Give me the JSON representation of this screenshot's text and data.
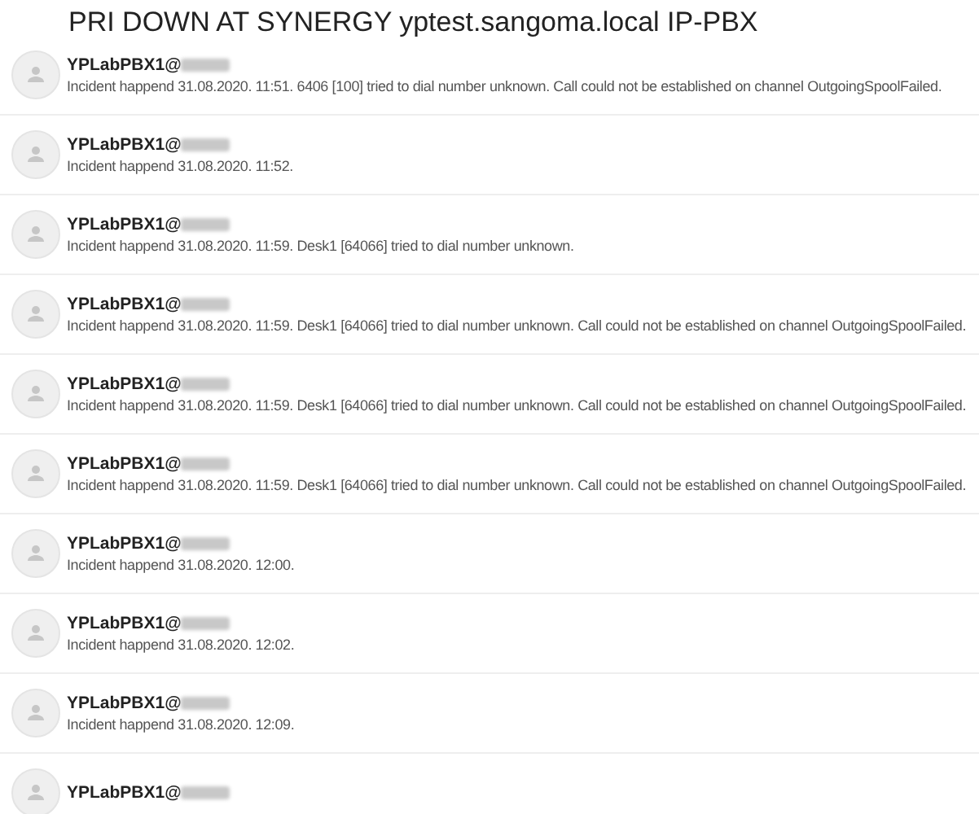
{
  "title": "PRI DOWN AT SYNERGY yptest.sangoma.local IP-PBX",
  "messages": [
    {
      "sender": "YPLabPBX1@",
      "redacted": true,
      "text": "Incident happend 31.08.2020. 11:51. 6406 [100] tried to dial number unknown. Call could not be established on channel OutgoingSpoolFailed."
    },
    {
      "sender": "YPLabPBX1@",
      "redacted": true,
      "text": "Incident happend 31.08.2020. 11:52."
    },
    {
      "sender": "YPLabPBX1@",
      "redacted": true,
      "text": "Incident happend 31.08.2020. 11:59. Desk1 [64066] tried to dial number unknown."
    },
    {
      "sender": "YPLabPBX1@",
      "redacted": true,
      "text": "Incident happend 31.08.2020. 11:59. Desk1 [64066] tried to dial number unknown. Call could not be established on channel OutgoingSpoolFailed."
    },
    {
      "sender": "YPLabPBX1@",
      "redacted": true,
      "text": "Incident happend 31.08.2020. 11:59. Desk1 [64066] tried to dial number unknown. Call could not be established on channel OutgoingSpoolFailed."
    },
    {
      "sender": "YPLabPBX1@",
      "redacted": true,
      "text": "Incident happend 31.08.2020. 11:59. Desk1 [64066] tried to dial number unknown. Call could not be established on channel OutgoingSpoolFailed."
    },
    {
      "sender": "YPLabPBX1@",
      "redacted": true,
      "text": "Incident happend 31.08.2020. 12:00."
    },
    {
      "sender": "YPLabPBX1@",
      "redacted": true,
      "text": "Incident happend 31.08.2020. 12:02."
    },
    {
      "sender": "YPLabPBX1@",
      "redacted": true,
      "text": "Incident happend 31.08.2020. 12:09."
    },
    {
      "sender": "YPLabPBX1@",
      "redacted": true
    }
  ]
}
